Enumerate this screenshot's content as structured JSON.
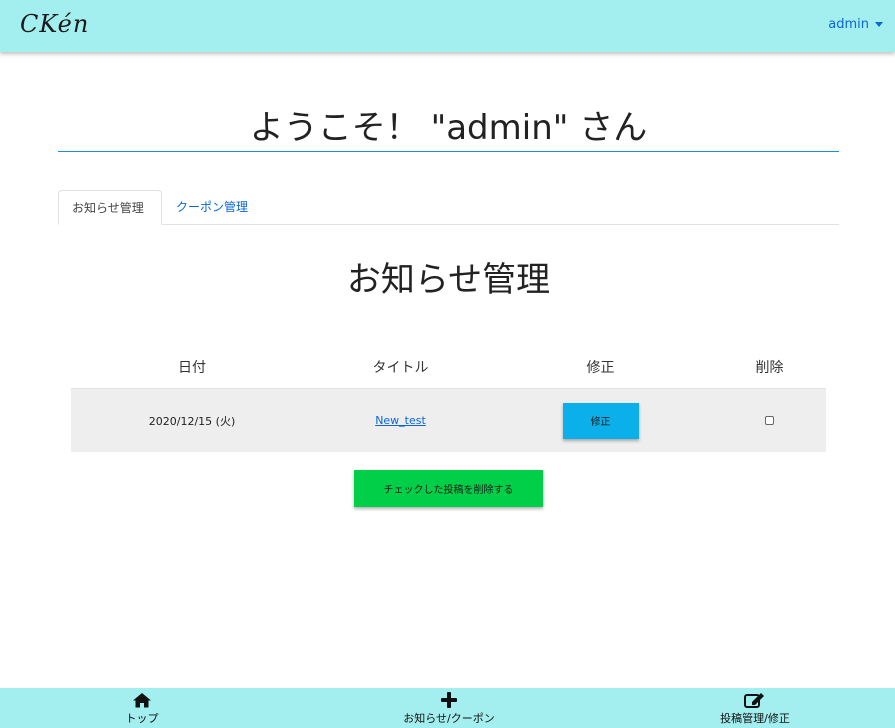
{
  "header": {
    "logo": "CKén",
    "user": "admin"
  },
  "welcome": "ようこそ！ \"admin\" さん",
  "tabs": [
    {
      "label": "お知らせ管理",
      "active": true
    },
    {
      "label": "クーポン管理",
      "active": false
    }
  ],
  "section_title": "お知らせ管理",
  "table": {
    "headers": [
      "日付",
      "タイトル",
      "修正",
      "削除"
    ],
    "rows": [
      {
        "date": "2020/12/15 (火)",
        "title": "New_test",
        "edit_label": "修正",
        "checked": false
      }
    ]
  },
  "bulk_delete_label": "チェックした投稿を削除する",
  "bottom_nav": [
    {
      "label": "トップ",
      "icon": "home-icon"
    },
    {
      "label": "お知らせ/クーポン",
      "icon": "plus-icon"
    },
    {
      "label": "投稿管理/修正",
      "icon": "edit-icon"
    }
  ],
  "colors": {
    "bar": "#a3eeee",
    "link": "#0b66d6",
    "edit_button": "#0bb0ea",
    "delete_button": "#00cf47"
  }
}
